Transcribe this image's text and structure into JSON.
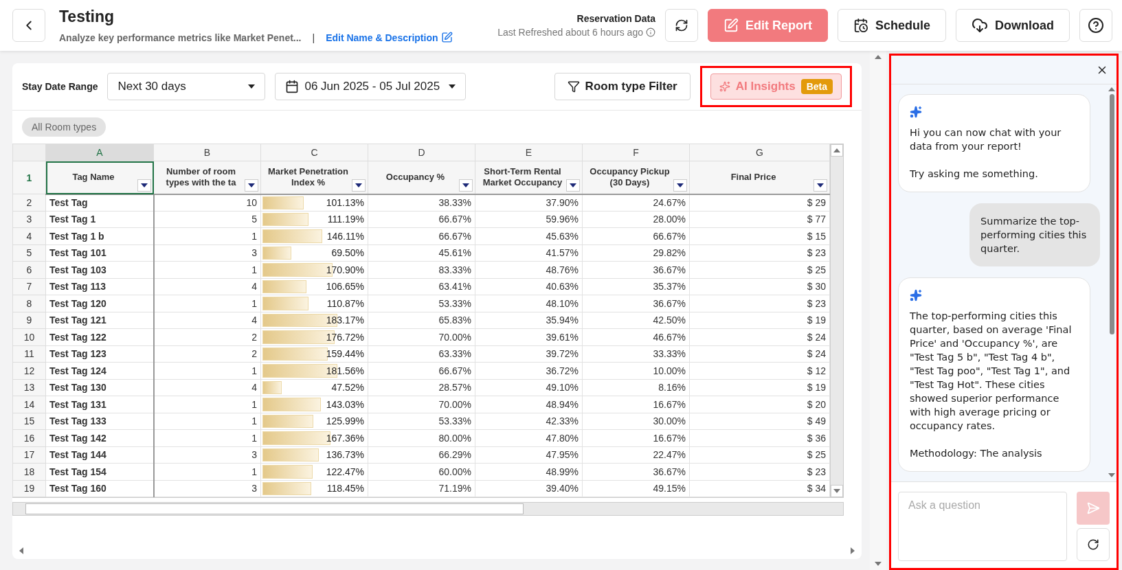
{
  "header": {
    "title": "Testing",
    "description": "Analyze key performance metrics like Market Penet...",
    "separator": "|",
    "edit_link": "Edit Name & Description",
    "data_source": "Reservation Data",
    "refreshed": "Last Refreshed about 6 hours ago",
    "buttons": [
      {
        "kind": "refresh"
      },
      {
        "kind": "edit",
        "label": "Edit Report"
      },
      {
        "kind": "schedule",
        "label": "Schedule"
      },
      {
        "kind": "download",
        "label": "Download"
      },
      {
        "kind": "help"
      }
    ]
  },
  "filters": {
    "date_range_label": "Stay Date Range",
    "range_select": "Next 30 days",
    "dates": "06 Jun 2025 - 05 Jul 2025",
    "room_filter": "Room type Filter",
    "ai_button": {
      "label": "AI Insights",
      "badge": "Beta",
      "highlighted": true
    },
    "chips": [
      "All Room types"
    ]
  },
  "table": {
    "header_row": "1",
    "columns": [
      {
        "letter": "A",
        "label": "Tag Name",
        "selected": true
      },
      {
        "letter": "B",
        "label": "Number of room types with the ta",
        "selected": false
      },
      {
        "letter": "C",
        "label": "Market Penetration Index %",
        "selected": false
      },
      {
        "letter": "D",
        "label": "Occupancy %",
        "selected": false
      },
      {
        "letter": "E",
        "label": "Short-Term Rental Market Occupancy",
        "selected": false
      },
      {
        "letter": "F",
        "label": "Occupancy Pickup (30 Days)",
        "selected": false
      },
      {
        "letter": "G",
        "label": "Final Price",
        "selected": false
      }
    ],
    "rows": [
      {
        "num": "2",
        "name": "Test Tag",
        "rooms": "10",
        "penetration": "101.13%",
        "level": 0.39,
        "occupancy": "38.33%",
        "str": "37.90%",
        "pickup": "24.67%",
        "price": "$ 29"
      },
      {
        "num": "3",
        "name": "Test Tag 1",
        "rooms": "5",
        "penetration": "111.19%",
        "level": 0.43,
        "occupancy": "66.67%",
        "str": "59.96%",
        "pickup": "28.00%",
        "price": "$ 77"
      },
      {
        "num": "4",
        "name": "Test Tag 1 b",
        "rooms": "1",
        "penetration": "146.11%",
        "level": 0.56,
        "occupancy": "66.67%",
        "str": "45.63%",
        "pickup": "66.67%",
        "price": "$ 15"
      },
      {
        "num": "5",
        "name": "Test Tag 101",
        "rooms": "3",
        "penetration": "69.50%",
        "level": 0.27,
        "occupancy": "45.61%",
        "str": "41.57%",
        "pickup": "29.82%",
        "price": "$ 23"
      },
      {
        "num": "6",
        "name": "Test Tag 103",
        "rooms": "1",
        "penetration": "170.90%",
        "level": 0.66,
        "occupancy": "83.33%",
        "str": "48.76%",
        "pickup": "36.67%",
        "price": "$ 25"
      },
      {
        "num": "7",
        "name": "Test Tag 113",
        "rooms": "4",
        "penetration": "106.65%",
        "level": 0.41,
        "occupancy": "63.41%",
        "str": "40.63%",
        "pickup": "35.37%",
        "price": "$ 30"
      },
      {
        "num": "8",
        "name": "Test Tag 120",
        "rooms": "1",
        "penetration": "110.87%",
        "level": 0.43,
        "occupancy": "53.33%",
        "str": "48.10%",
        "pickup": "36.67%",
        "price": "$ 23"
      },
      {
        "num": "9",
        "name": "Test Tag 121",
        "rooms": "4",
        "penetration": "183.17%",
        "level": 0.7,
        "occupancy": "65.83%",
        "str": "35.94%",
        "pickup": "42.50%",
        "price": "$ 19"
      },
      {
        "num": "10",
        "name": "Test Tag 122",
        "rooms": "2",
        "penetration": "176.72%",
        "level": 0.68,
        "occupancy": "70.00%",
        "str": "39.61%",
        "pickup": "46.67%",
        "price": "$ 24"
      },
      {
        "num": "11",
        "name": "Test Tag 123",
        "rooms": "2",
        "penetration": "159.44%",
        "level": 0.61,
        "occupancy": "63.33%",
        "str": "39.72%",
        "pickup": "33.33%",
        "price": "$ 24"
      },
      {
        "num": "12",
        "name": "Test Tag 124",
        "rooms": "1",
        "penetration": "181.56%",
        "level": 0.7,
        "occupancy": "66.67%",
        "str": "36.72%",
        "pickup": "10.00%",
        "price": "$ 12"
      },
      {
        "num": "13",
        "name": "Test Tag 130",
        "rooms": "4",
        "penetration": "47.52%",
        "level": 0.18,
        "occupancy": "28.57%",
        "str": "49.10%",
        "pickup": "8.16%",
        "price": "$ 19"
      },
      {
        "num": "14",
        "name": "Test Tag 131",
        "rooms": "1",
        "penetration": "143.03%",
        "level": 0.55,
        "occupancy": "70.00%",
        "str": "48.94%",
        "pickup": "16.67%",
        "price": "$ 20"
      },
      {
        "num": "15",
        "name": "Test Tag 133",
        "rooms": "1",
        "penetration": "125.99%",
        "level": 0.48,
        "occupancy": "53.33%",
        "str": "42.33%",
        "pickup": "30.00%",
        "price": "$ 49"
      },
      {
        "num": "16",
        "name": "Test Tag 142",
        "rooms": "1",
        "penetration": "167.36%",
        "level": 0.64,
        "occupancy": "80.00%",
        "str": "47.80%",
        "pickup": "16.67%",
        "price": "$ 36"
      },
      {
        "num": "17",
        "name": "Test Tag 144",
        "rooms": "3",
        "penetration": "136.73%",
        "level": 0.53,
        "occupancy": "66.29%",
        "str": "47.95%",
        "pickup": "22.47%",
        "price": "$ 25"
      },
      {
        "num": "18",
        "name": "Test Tag 154",
        "rooms": "1",
        "penetration": "122.47%",
        "level": 0.47,
        "occupancy": "60.00%",
        "str": "48.99%",
        "pickup": "36.67%",
        "price": "$ 23"
      },
      {
        "num": "19",
        "name": "Test Tag 160",
        "rooms": "3",
        "penetration": "118.45%",
        "level": 0.46,
        "occupancy": "71.19%",
        "str": "39.40%",
        "pickup": "49.15%",
        "price": "$ 34"
      }
    ]
  },
  "chat": {
    "highlighted": true,
    "messages": [
      {
        "kind": "bot",
        "paragraphs": [
          "Hi you can now chat with your data from your report!",
          "Try asking me something."
        ]
      },
      {
        "kind": "user",
        "paragraphs": [
          "Summarize the top-performing cities this quarter."
        ]
      },
      {
        "kind": "bot",
        "paragraphs": [
          "The top-performing cities this quarter, based on average 'Final Price' and 'Occupancy %', are \"Test Tag 5 b\", \"Test Tag 4 b\", \"Test Tag poo\", \"Test Tag 1\", and \"Test Tag Hot\". These cities showed superior performance with high average pricing or occupancy rates.",
          "Methodology: The analysis"
        ]
      }
    ],
    "input_placeholder": "Ask a question"
  }
}
